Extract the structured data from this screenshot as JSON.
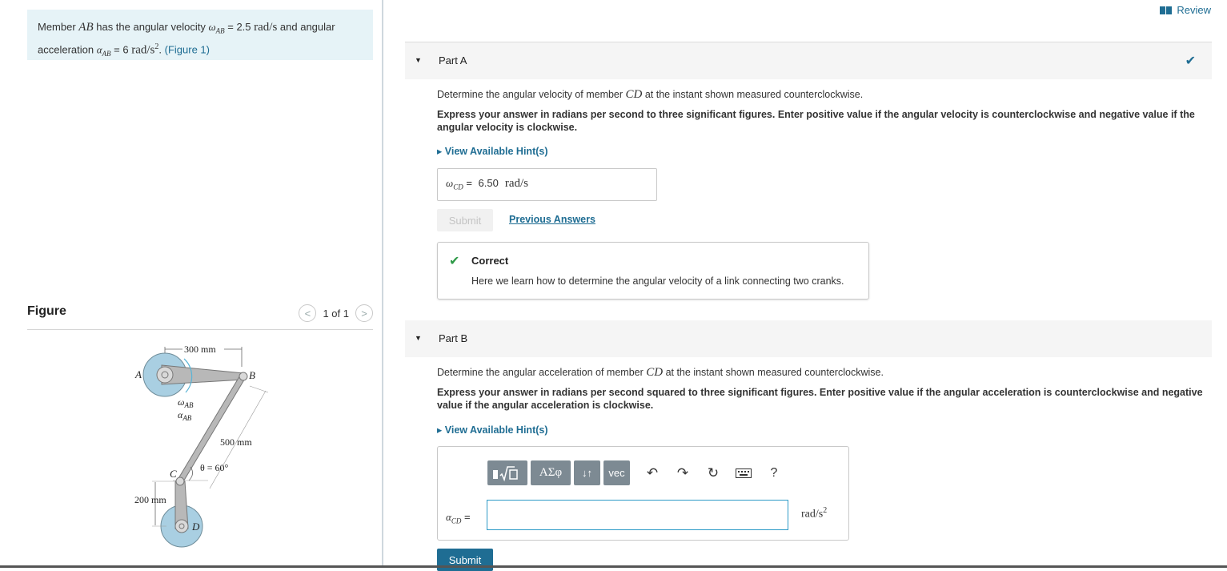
{
  "problem": {
    "t1": "Member ",
    "member_ab": "AB",
    "t2": " has the angular velocity ",
    "omega_ab": "ω",
    "sub_ab": "AB",
    "t3": " = 2.5 ",
    "unit_w": "rad/s",
    "t4": " and angular acceleration ",
    "alpha_ab": "α",
    "sub_ab2": "AB",
    "t5": " = 6 ",
    "unit_a": "rad/s",
    "sq": "2",
    "t6": ". ",
    "figure_link": "(Figure 1)"
  },
  "figure_panel": {
    "title": "Figure",
    "pager": "1 of 1",
    "labels": {
      "dim_300": "300 mm",
      "dim_500": "500 mm",
      "dim_200": "200 mm",
      "theta": "θ = 60°",
      "A": "A",
      "B": "B",
      "C": "C",
      "D": "D",
      "omega": "ω",
      "alpha": "α",
      "sub": "AB"
    }
  },
  "review": "Review",
  "partA": {
    "label": "Part A",
    "q1": "Determine the angular velocity of member ",
    "q_member": "CD",
    "q2": " at the instant shown measured counterclockwise.",
    "instruction": "Express your answer in radians per second to three significant figures. Enter positive value if the angular velocity is counterclockwise and negative value if the angular velocity is clockwise.",
    "hint": "View Available Hint(s)",
    "answer_symbol": "ω",
    "answer_sub": "CD",
    "answer_eq": " = ",
    "answer_value": "6.50",
    "answer_unit": "rad/s",
    "submit": "Submit",
    "previous": "Previous Answers",
    "feedback_title": "Correct",
    "feedback_text": "Here we learn how to determine the angular velocity of a link connecting two cranks."
  },
  "partB": {
    "label": "Part B",
    "q1": "Determine the angular acceleration of member ",
    "q_member": "CD",
    "q2": " at the instant shown measured counterclockwise.",
    "instruction": "Express your answer in radians per second squared to three significant figures. Enter positive value if the angular acceleration is counterclockwise and negative value if the angular acceleration is clockwise.",
    "hint": "View Available Hint(s)",
    "toolbar": {
      "greek": "ΑΣφ",
      "sort": "↓↑",
      "vec": "vec",
      "help": "?"
    },
    "answer_symbol": "α",
    "answer_sub": "CD",
    "answer_eq": " =",
    "answer_value": "",
    "answer_unit": "rad/s",
    "unit_sq": "2",
    "submit": "Submit"
  }
}
